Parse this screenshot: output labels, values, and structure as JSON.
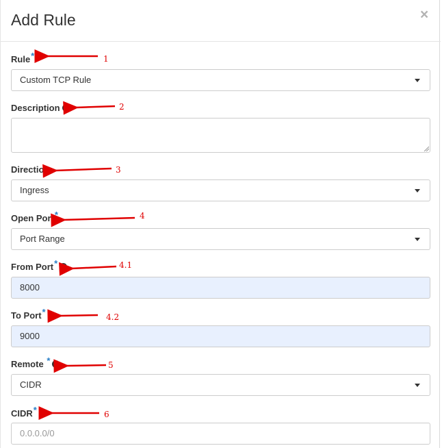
{
  "dialog": {
    "title": "Add Rule",
    "close_glyph": "×"
  },
  "form": {
    "rule": {
      "label": "Rule",
      "required": "*",
      "value": "Custom TCP Rule"
    },
    "description": {
      "label": "Description",
      "value": ""
    },
    "direction": {
      "label": "Direction",
      "value": "Ingress"
    },
    "open_port": {
      "label": "Open Port",
      "required": "*",
      "value": "Port Range"
    },
    "from_port": {
      "label": "From Port",
      "required": "*",
      "value": "8000"
    },
    "to_port": {
      "label": "To Port",
      "required": "*",
      "value": "9000"
    },
    "remote": {
      "label": "Remote",
      "required": "*",
      "value": "CIDR"
    },
    "cidr": {
      "label": "CIDR",
      "required": "*",
      "placeholder": "0.0.0.0/0"
    }
  },
  "help_glyph": "?",
  "annotations": {
    "color": "#e00000",
    "labels": [
      "1",
      "2",
      "3",
      "4",
      "4.1",
      "4.2",
      "5",
      "6"
    ]
  },
  "icons": {
    "help": "question-circle-icon",
    "dropdown": "caret-down-icon",
    "close": "close-icon",
    "annotation": "red-arrow-icon"
  }
}
